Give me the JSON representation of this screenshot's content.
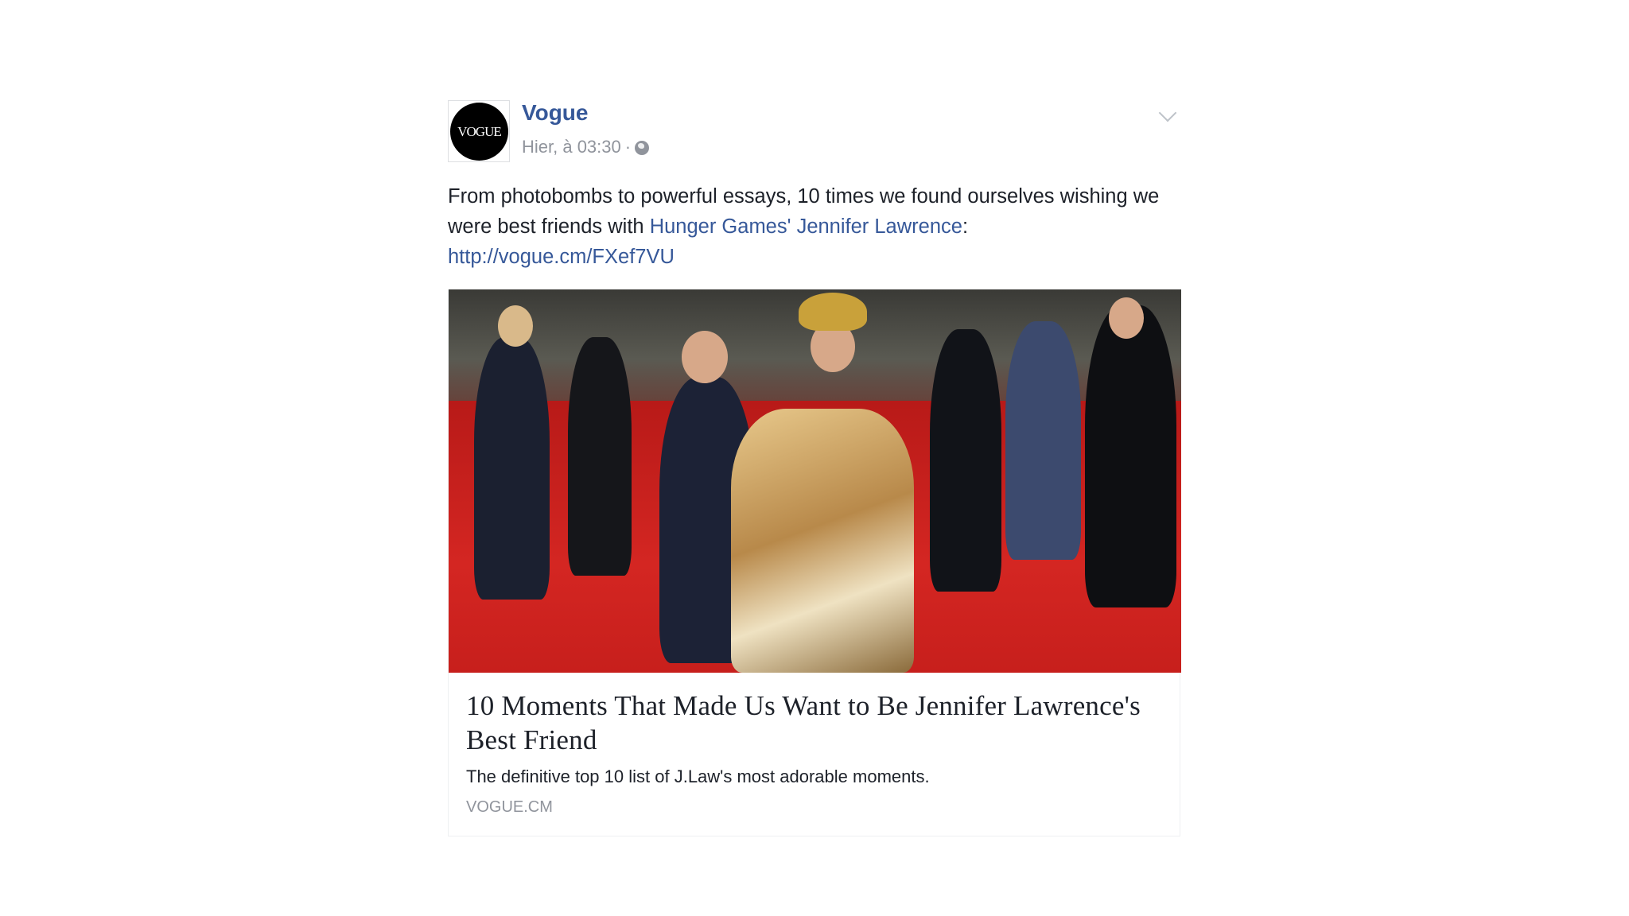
{
  "post": {
    "page_name": "Vogue",
    "avatar_text": "VOGUE",
    "timestamp": "Hier, à 03:30",
    "separator": "·",
    "audience_icon": "globe-icon",
    "menu_icon": "chevron-down-icon",
    "text": {
      "part1": "From photobombs to powerful essays, 10 times we found ourselves wishing we were best friends with ",
      "link1": "Hunger Games' Jennifer Lawrence",
      "part2": ":",
      "url": "http://vogue.cm/FXef7VU"
    }
  },
  "link_card": {
    "image_description_colors": {
      "carpet": "#c41f1d"
    },
    "title": "10 Moments That Made Us Want to Be Jennifer Lawrence's Best Friend",
    "description": "The definitive top 10 list of J.Law's most adorable moments.",
    "domain": "VOGUE.CM"
  },
  "colors": {
    "link": "#365899",
    "meta": "#90949c",
    "text": "#1d2129"
  }
}
